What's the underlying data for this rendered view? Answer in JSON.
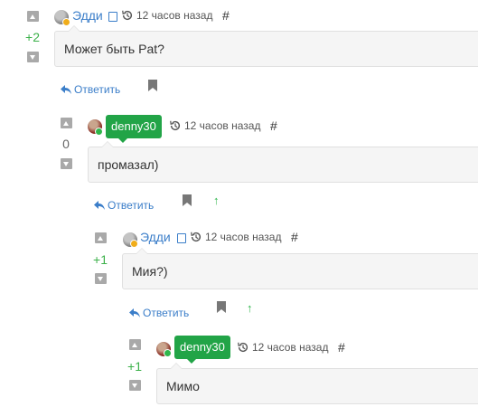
{
  "thread": {
    "comments": [
      {
        "author": "Эдди",
        "author_style": "link",
        "status": "away",
        "time": "12 часов назад",
        "permalink": "#",
        "score": "+2",
        "body": "Может быть Pat?",
        "reply_label": "Ответить",
        "has_parent_link": false
      },
      {
        "author": "denny30",
        "author_style": "badge",
        "status": "online",
        "time": "12 часов назад",
        "permalink": "#",
        "score": "0",
        "body": "промазал)",
        "reply_label": "Ответить",
        "has_parent_link": true,
        "parent_link": "↑"
      },
      {
        "author": "Эдди",
        "author_style": "link",
        "status": "away",
        "time": "12 часов назад",
        "permalink": "#",
        "score": "+1",
        "body": "Мия?)",
        "reply_label": "Ответить",
        "has_parent_link": true,
        "parent_link": "↑"
      },
      {
        "author": "denny30",
        "author_style": "badge",
        "status": "online",
        "time": "12 часов назад",
        "permalink": "#",
        "score": "+1",
        "body": "Мимо"
      }
    ]
  },
  "colors": {
    "link": "#3b7ec9",
    "score_positive": "#3cb14a",
    "author_badge": "#22a447",
    "status_online": "#2fb64b",
    "status_away": "#f0ad1b",
    "vote_arrow": "#a9a9a9",
    "bubble_bg": "#f5f5f5"
  },
  "icons": {
    "vote_up": "triangle-up-icon",
    "vote_down": "triangle-down-icon",
    "time": "history-clock-icon",
    "reply": "reply-arrow-icon",
    "bookmark": "bookmark-icon",
    "parent": "arrow-up-icon"
  }
}
